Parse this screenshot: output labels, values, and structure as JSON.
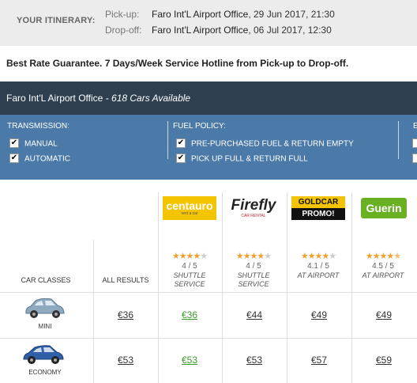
{
  "itinerary": {
    "title": "YOUR ITINERARY:",
    "pickup_label": "Pick-up:",
    "pickup_location": "Faro Int'L Airport Office",
    "pickup_time": ", 29 Jun 2017, 21:30",
    "dropoff_label": "Drop-off:",
    "dropoff_location": "Faro Int'L Airport Office",
    "dropoff_time": ", 06 Jul 2017, 12:30"
  },
  "guarantee": "Best Rate Guarantee. 7 Days/Week Service Hotline from Pick-up to Drop-off.",
  "location_bar": {
    "name": "Faro Int'L Airport Office",
    "separator": " - ",
    "count": "618 Cars Available"
  },
  "filters": {
    "transmission": {
      "title": "TRANSMISSION:",
      "options": [
        {
          "label": "MANUAL",
          "checked": true
        },
        {
          "label": "AUTOMATIC",
          "checked": true
        }
      ]
    },
    "fuel": {
      "title": "FUEL POLICY:",
      "options": [
        {
          "label": "PRE-PURCHASED FUEL & RETURN EMPTY",
          "checked": true
        },
        {
          "label": "PICK UP FULL & RETURN FULL",
          "checked": true
        }
      ]
    },
    "third_title": "E"
  },
  "table": {
    "car_classes_label": "CAR CLASSES",
    "all_results_label": "ALL RESULTS",
    "suppliers": [
      {
        "logo": "centauro",
        "logo_sub": "rent a car",
        "rating_value": 4,
        "rating": "4 / 5",
        "service": [
          "SHUTTLE",
          "SERVICE"
        ]
      },
      {
        "logo": "Firefly",
        "logo_sub": "CAR RENTAL",
        "rating_value": 4,
        "rating": "4 / 5",
        "service": [
          "SHUTTLE",
          "SERVICE"
        ]
      },
      {
        "logo": "GOLDCAR",
        "logo_sub": "PROMO!",
        "rating_value": 4.1,
        "rating": "4.1 / 5",
        "service": [
          "AT AIRPORT"
        ]
      },
      {
        "logo": "Guerin",
        "logo_sub": "",
        "rating_value": 4.5,
        "rating": "4.5 / 5",
        "service": [
          "AT AIRPORT"
        ]
      }
    ],
    "rows": [
      {
        "car_class": "MINI",
        "car_color": "#8fa9bf",
        "all": "€36",
        "prices": [
          "€36",
          "€44",
          "€49",
          "€49"
        ]
      },
      {
        "car_class": "ECONOMY",
        "car_color": "#2f5fa8",
        "all": "€53",
        "prices": [
          "€53",
          "€53",
          "€57",
          "€59"
        ]
      }
    ]
  },
  "colors": {
    "location_bar": "#2e3f4f",
    "filter_panel": "#4b7aa8",
    "best_price": "#3a9b2a",
    "star": "#f0a030"
  }
}
